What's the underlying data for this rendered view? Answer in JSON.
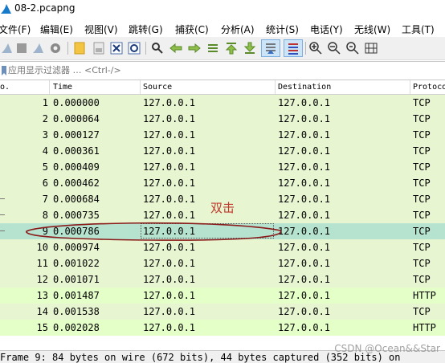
{
  "window": {
    "title": "08-2.pcapng"
  },
  "menu": [
    {
      "label": "文件(F)"
    },
    {
      "label": "编辑(E)"
    },
    {
      "label": "视图(V)"
    },
    {
      "label": "跳转(G)"
    },
    {
      "label": "捕获(C)"
    },
    {
      "label": "分析(A)"
    },
    {
      "label": "统计(S)"
    },
    {
      "label": "电话(Y)"
    },
    {
      "label": "无线(W)"
    },
    {
      "label": "工具(T)"
    }
  ],
  "toolbar": [
    {
      "icon": "start-capture-icon"
    },
    {
      "icon": "stop-capture-icon"
    },
    {
      "icon": "restart-capture-icon"
    },
    {
      "icon": "capture-options-icon"
    },
    {
      "icon": "open-file-icon"
    },
    {
      "icon": "save-file-icon"
    },
    {
      "icon": "close-file-icon"
    },
    {
      "icon": "reload-file-icon"
    },
    {
      "icon": "find-packet-icon"
    },
    {
      "icon": "go-back-icon"
    },
    {
      "icon": "go-forward-icon"
    },
    {
      "icon": "go-to-packet-icon"
    },
    {
      "icon": "first-packet-icon"
    },
    {
      "icon": "last-packet-icon"
    },
    {
      "icon": "auto-scroll-icon"
    },
    {
      "icon": "colorize-icon"
    },
    {
      "icon": "zoom-in-icon"
    },
    {
      "icon": "zoom-out-icon"
    },
    {
      "icon": "normal-size-icon"
    },
    {
      "icon": "resize-columns-icon"
    }
  ],
  "filter": {
    "placeholder": "应用显示过滤器 … <Ctrl-/>"
  },
  "columns": {
    "no": "o.",
    "time": "Time",
    "source": "Source",
    "destination": "Destination",
    "protocol": "Protoco"
  },
  "packets": [
    {
      "no": "1",
      "time": "0.000000",
      "source": "127.0.0.1",
      "destination": "127.0.0.1",
      "protocol": "TCP"
    },
    {
      "no": "2",
      "time": "0.000064",
      "source": "127.0.0.1",
      "destination": "127.0.0.1",
      "protocol": "TCP"
    },
    {
      "no": "3",
      "time": "0.000127",
      "source": "127.0.0.1",
      "destination": "127.0.0.1",
      "protocol": "TCP"
    },
    {
      "no": "4",
      "time": "0.000361",
      "source": "127.0.0.1",
      "destination": "127.0.0.1",
      "protocol": "TCP"
    },
    {
      "no": "5",
      "time": "0.000409",
      "source": "127.0.0.1",
      "destination": "127.0.0.1",
      "protocol": "TCP"
    },
    {
      "no": "6",
      "time": "0.000462",
      "source": "127.0.0.1",
      "destination": "127.0.0.1",
      "protocol": "TCP"
    },
    {
      "no": "7",
      "time": "0.000684",
      "source": "127.0.0.1",
      "destination": "127.0.0.1",
      "protocol": "TCP"
    },
    {
      "no": "8",
      "time": "0.000735",
      "source": "127.0.0.1",
      "destination": "127.0.0.1",
      "protocol": "TCP"
    },
    {
      "no": "9",
      "time": "0.000786",
      "source": "127.0.0.1",
      "destination": "127.0.0.1",
      "protocol": "TCP",
      "selected": true
    },
    {
      "no": "10",
      "time": "0.000974",
      "source": "127.0.0.1",
      "destination": "127.0.0.1",
      "protocol": "TCP"
    },
    {
      "no": "11",
      "time": "0.001022",
      "source": "127.0.0.1",
      "destination": "127.0.0.1",
      "protocol": "TCP"
    },
    {
      "no": "12",
      "time": "0.001071",
      "source": "127.0.0.1",
      "destination": "127.0.0.1",
      "protocol": "TCP"
    },
    {
      "no": "13",
      "time": "0.001487",
      "source": "127.0.0.1",
      "destination": "127.0.0.1",
      "protocol": "HTTP"
    },
    {
      "no": "14",
      "time": "0.001538",
      "source": "127.0.0.1",
      "destination": "127.0.0.1",
      "protocol": "TCP"
    },
    {
      "no": "15",
      "time": "0.002028",
      "source": "127.0.0.1",
      "destination": "127.0.0.1",
      "protocol": "HTTP"
    }
  ],
  "annotation": {
    "text": "双击"
  },
  "status": {
    "text": "Frame 9: 84 bytes on wire (672 bits), 44 bytes captured (352 bits) on"
  },
  "watermark": {
    "text": "CSDN @Ocean&&Star"
  },
  "colors": {
    "tcp_row": "#e7f5d0",
    "http_row": "#e4ffc7",
    "selected_row": "#b5e3cf",
    "annotation": "#c0392b"
  }
}
